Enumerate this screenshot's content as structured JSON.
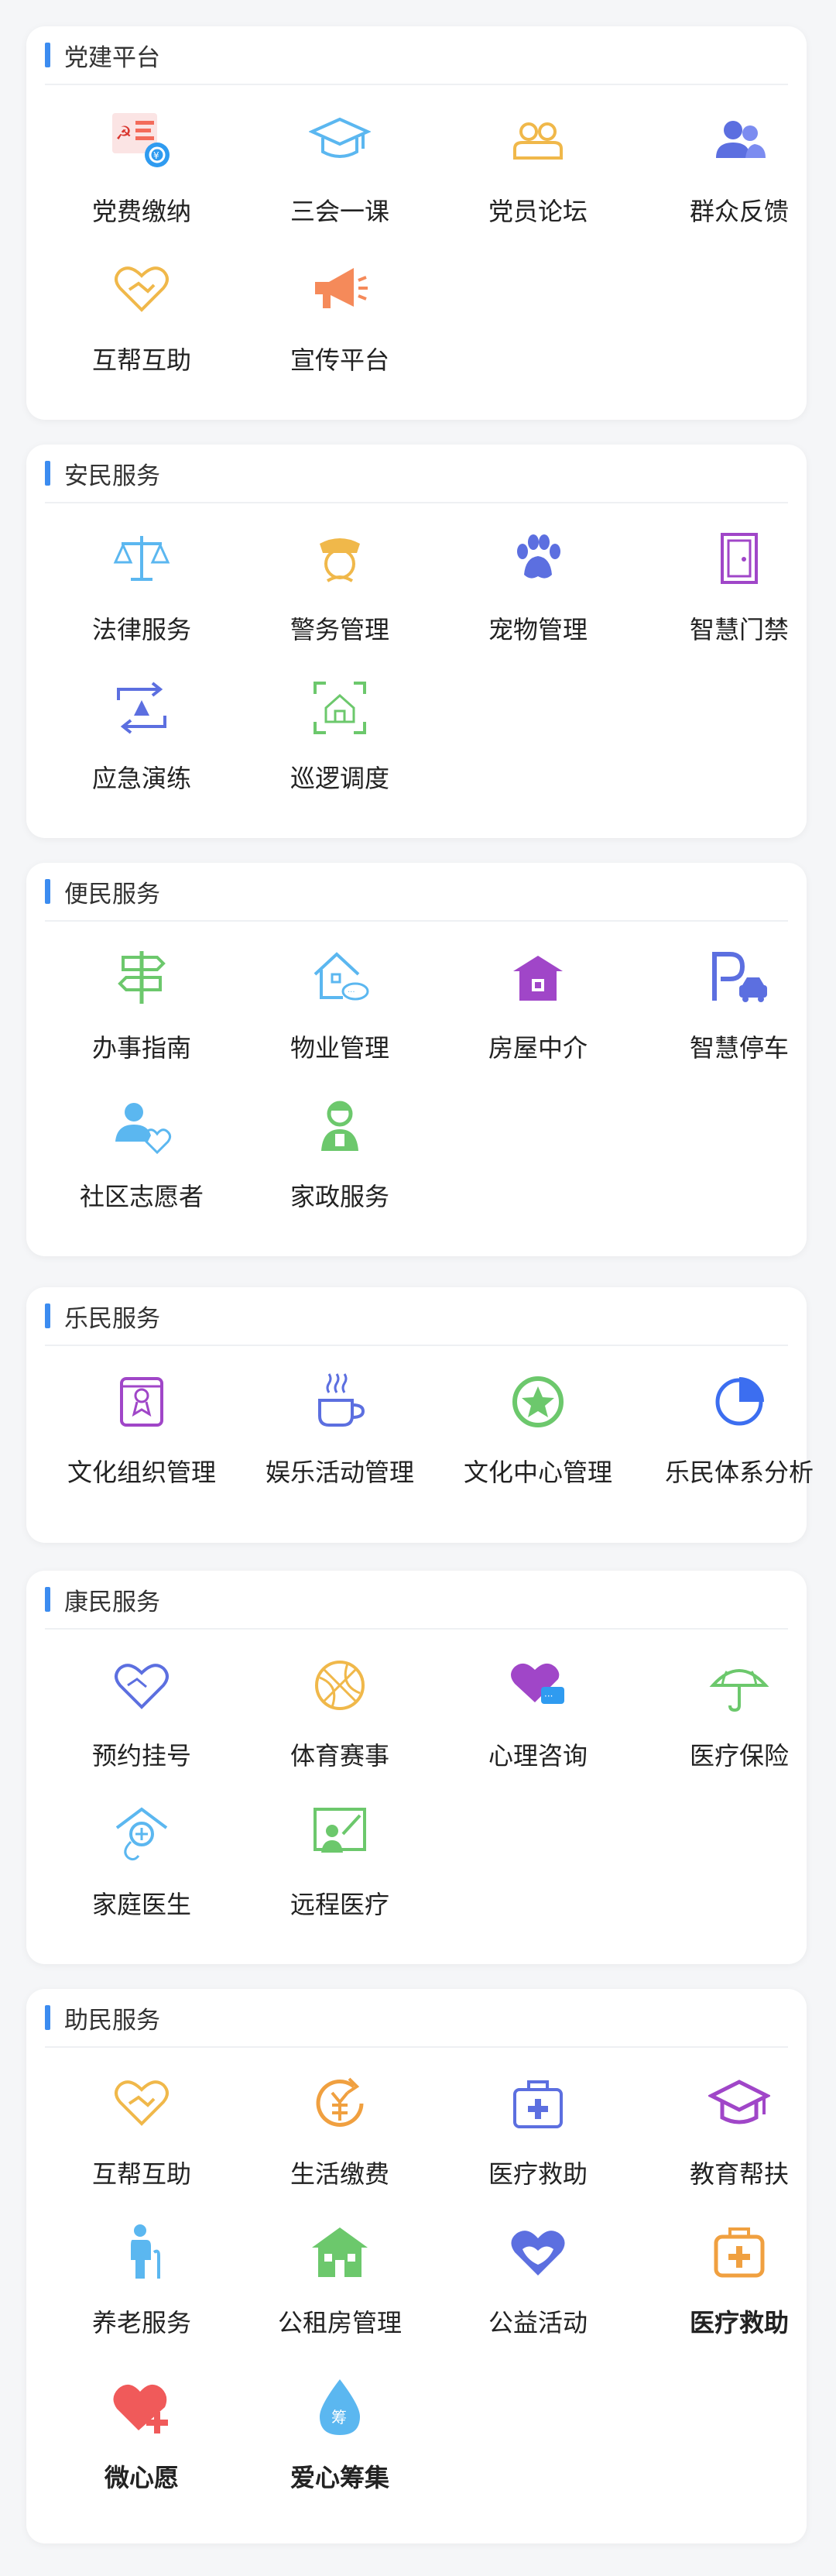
{
  "sections": [
    {
      "title": "党建平台",
      "items": [
        {
          "label": "党费缴纳",
          "icon": "party-fee-icon"
        },
        {
          "label": "三会一课",
          "icon": "graduation-cap-icon"
        },
        {
          "label": "党员论坛",
          "icon": "members-icon"
        },
        {
          "label": "群众反馈",
          "icon": "people-feedback-icon"
        },
        {
          "label": "互帮互助",
          "icon": "heart-hands-icon"
        },
        {
          "label": "宣传平台",
          "icon": "megaphone-icon"
        }
      ]
    },
    {
      "title": "安民服务",
      "items": [
        {
          "label": "法律服务",
          "icon": "scales-icon"
        },
        {
          "label": "警务管理",
          "icon": "police-icon"
        },
        {
          "label": "宠物管理",
          "icon": "paw-icon"
        },
        {
          "label": "智慧门禁",
          "icon": "door-icon"
        },
        {
          "label": "应急演练",
          "icon": "emergency-icon"
        },
        {
          "label": "巡逻调度",
          "icon": "patrol-icon"
        }
      ]
    },
    {
      "title": "便民服务",
      "items": [
        {
          "label": "办事指南",
          "icon": "signpost-icon"
        },
        {
          "label": "物业管理",
          "icon": "property-icon"
        },
        {
          "label": "房屋中介",
          "icon": "house-icon"
        },
        {
          "label": "智慧停车",
          "icon": "parking-icon"
        },
        {
          "label": "社区志愿者",
          "icon": "volunteer-icon"
        },
        {
          "label": "家政服务",
          "icon": "housekeeping-icon"
        }
      ]
    },
    {
      "title": "乐民服务",
      "items": [
        {
          "label": "文化组织管理",
          "icon": "culture-org-icon"
        },
        {
          "label": "娱乐活动管理",
          "icon": "coffee-icon"
        },
        {
          "label": "文化中心管理",
          "icon": "star-circle-icon"
        },
        {
          "label": "乐民体系分析",
          "icon": "pie-chart-icon"
        }
      ]
    },
    {
      "title": "康民服务",
      "items": [
        {
          "label": "预约挂号",
          "icon": "heart-outline-icon"
        },
        {
          "label": "体育赛事",
          "icon": "basketball-icon"
        },
        {
          "label": "心理咨询",
          "icon": "heart-chat-icon"
        },
        {
          "label": "医疗保险",
          "icon": "umbrella-icon"
        },
        {
          "label": "家庭医生",
          "icon": "family-doctor-icon"
        },
        {
          "label": "远程医疗",
          "icon": "remote-medical-icon"
        }
      ]
    },
    {
      "title": "助民服务",
      "items": [
        {
          "label": "互帮互助",
          "icon": "heart-hands-icon"
        },
        {
          "label": "生活缴费",
          "icon": "payment-icon"
        },
        {
          "label": "医疗救助",
          "icon": "medical-kit-icon"
        },
        {
          "label": "教育帮扶",
          "icon": "education-icon"
        },
        {
          "label": "养老服务",
          "icon": "elderly-icon"
        },
        {
          "label": "公租房管理",
          "icon": "public-housing-icon"
        },
        {
          "label": "公益活动",
          "icon": "charity-icon"
        },
        {
          "label": "医疗救助",
          "icon": "first-aid-icon",
          "bold": true
        },
        {
          "label": "微心愿",
          "icon": "wish-heart-icon",
          "bold": true
        },
        {
          "label": "爱心筹集",
          "icon": "fundraise-drop-icon",
          "bold": true
        }
      ]
    }
  ]
}
